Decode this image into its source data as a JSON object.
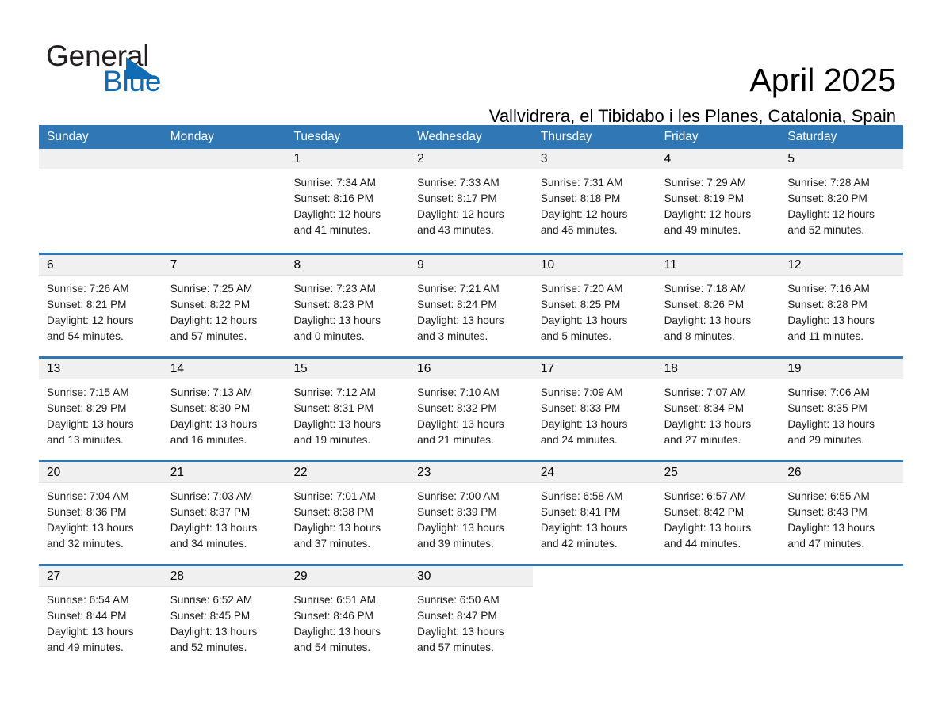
{
  "brand": {
    "word_one": "General",
    "word_two": "Blue",
    "accent_color": "#0f6cb5"
  },
  "header": {
    "month_title": "April 2025",
    "location": "Vallvidrera, el Tibidabo i les Planes, Catalonia, Spain",
    "header_bg": "#2f78b5",
    "day_band_bg": "#f0f0f0"
  },
  "calendar": {
    "weekdays": [
      "Sunday",
      "Monday",
      "Tuesday",
      "Wednesday",
      "Thursday",
      "Friday",
      "Saturday"
    ],
    "weeks": [
      [
        {
          "day": "",
          "sunrise": "",
          "sunset": "",
          "daylight_1": "",
          "daylight_2": "",
          "empty": true
        },
        {
          "day": "",
          "sunrise": "",
          "sunset": "",
          "daylight_1": "",
          "daylight_2": "",
          "empty": true
        },
        {
          "day": "1",
          "sunrise": "Sunrise: 7:34 AM",
          "sunset": "Sunset: 8:16 PM",
          "daylight_1": "Daylight: 12 hours",
          "daylight_2": "and 41 minutes."
        },
        {
          "day": "2",
          "sunrise": "Sunrise: 7:33 AM",
          "sunset": "Sunset: 8:17 PM",
          "daylight_1": "Daylight: 12 hours",
          "daylight_2": "and 43 minutes."
        },
        {
          "day": "3",
          "sunrise": "Sunrise: 7:31 AM",
          "sunset": "Sunset: 8:18 PM",
          "daylight_1": "Daylight: 12 hours",
          "daylight_2": "and 46 minutes."
        },
        {
          "day": "4",
          "sunrise": "Sunrise: 7:29 AM",
          "sunset": "Sunset: 8:19 PM",
          "daylight_1": "Daylight: 12 hours",
          "daylight_2": "and 49 minutes."
        },
        {
          "day": "5",
          "sunrise": "Sunrise: 7:28 AM",
          "sunset": "Sunset: 8:20 PM",
          "daylight_1": "Daylight: 12 hours",
          "daylight_2": "and 52 minutes."
        }
      ],
      [
        {
          "day": "6",
          "sunrise": "Sunrise: 7:26 AM",
          "sunset": "Sunset: 8:21 PM",
          "daylight_1": "Daylight: 12 hours",
          "daylight_2": "and 54 minutes."
        },
        {
          "day": "7",
          "sunrise": "Sunrise: 7:25 AM",
          "sunset": "Sunset: 8:22 PM",
          "daylight_1": "Daylight: 12 hours",
          "daylight_2": "and 57 minutes."
        },
        {
          "day": "8",
          "sunrise": "Sunrise: 7:23 AM",
          "sunset": "Sunset: 8:23 PM",
          "daylight_1": "Daylight: 13 hours",
          "daylight_2": "and 0 minutes."
        },
        {
          "day": "9",
          "sunrise": "Sunrise: 7:21 AM",
          "sunset": "Sunset: 8:24 PM",
          "daylight_1": "Daylight: 13 hours",
          "daylight_2": "and 3 minutes."
        },
        {
          "day": "10",
          "sunrise": "Sunrise: 7:20 AM",
          "sunset": "Sunset: 8:25 PM",
          "daylight_1": "Daylight: 13 hours",
          "daylight_2": "and 5 minutes."
        },
        {
          "day": "11",
          "sunrise": "Sunrise: 7:18 AM",
          "sunset": "Sunset: 8:26 PM",
          "daylight_1": "Daylight: 13 hours",
          "daylight_2": "and 8 minutes."
        },
        {
          "day": "12",
          "sunrise": "Sunrise: 7:16 AM",
          "sunset": "Sunset: 8:28 PM",
          "daylight_1": "Daylight: 13 hours",
          "daylight_2": "and 11 minutes."
        }
      ],
      [
        {
          "day": "13",
          "sunrise": "Sunrise: 7:15 AM",
          "sunset": "Sunset: 8:29 PM",
          "daylight_1": "Daylight: 13 hours",
          "daylight_2": "and 13 minutes."
        },
        {
          "day": "14",
          "sunrise": "Sunrise: 7:13 AM",
          "sunset": "Sunset: 8:30 PM",
          "daylight_1": "Daylight: 13 hours",
          "daylight_2": "and 16 minutes."
        },
        {
          "day": "15",
          "sunrise": "Sunrise: 7:12 AM",
          "sunset": "Sunset: 8:31 PM",
          "daylight_1": "Daylight: 13 hours",
          "daylight_2": "and 19 minutes."
        },
        {
          "day": "16",
          "sunrise": "Sunrise: 7:10 AM",
          "sunset": "Sunset: 8:32 PM",
          "daylight_1": "Daylight: 13 hours",
          "daylight_2": "and 21 minutes."
        },
        {
          "day": "17",
          "sunrise": "Sunrise: 7:09 AM",
          "sunset": "Sunset: 8:33 PM",
          "daylight_1": "Daylight: 13 hours",
          "daylight_2": "and 24 minutes."
        },
        {
          "day": "18",
          "sunrise": "Sunrise: 7:07 AM",
          "sunset": "Sunset: 8:34 PM",
          "daylight_1": "Daylight: 13 hours",
          "daylight_2": "and 27 minutes."
        },
        {
          "day": "19",
          "sunrise": "Sunrise: 7:06 AM",
          "sunset": "Sunset: 8:35 PM",
          "daylight_1": "Daylight: 13 hours",
          "daylight_2": "and 29 minutes."
        }
      ],
      [
        {
          "day": "20",
          "sunrise": "Sunrise: 7:04 AM",
          "sunset": "Sunset: 8:36 PM",
          "daylight_1": "Daylight: 13 hours",
          "daylight_2": "and 32 minutes."
        },
        {
          "day": "21",
          "sunrise": "Sunrise: 7:03 AM",
          "sunset": "Sunset: 8:37 PM",
          "daylight_1": "Daylight: 13 hours",
          "daylight_2": "and 34 minutes."
        },
        {
          "day": "22",
          "sunrise": "Sunrise: 7:01 AM",
          "sunset": "Sunset: 8:38 PM",
          "daylight_1": "Daylight: 13 hours",
          "daylight_2": "and 37 minutes."
        },
        {
          "day": "23",
          "sunrise": "Sunrise: 7:00 AM",
          "sunset": "Sunset: 8:39 PM",
          "daylight_1": "Daylight: 13 hours",
          "daylight_2": "and 39 minutes."
        },
        {
          "day": "24",
          "sunrise": "Sunrise: 6:58 AM",
          "sunset": "Sunset: 8:41 PM",
          "daylight_1": "Daylight: 13 hours",
          "daylight_2": "and 42 minutes."
        },
        {
          "day": "25",
          "sunrise": "Sunrise: 6:57 AM",
          "sunset": "Sunset: 8:42 PM",
          "daylight_1": "Daylight: 13 hours",
          "daylight_2": "and 44 minutes."
        },
        {
          "day": "26",
          "sunrise": "Sunrise: 6:55 AM",
          "sunset": "Sunset: 8:43 PM",
          "daylight_1": "Daylight: 13 hours",
          "daylight_2": "and 47 minutes."
        }
      ],
      [
        {
          "day": "27",
          "sunrise": "Sunrise: 6:54 AM",
          "sunset": "Sunset: 8:44 PM",
          "daylight_1": "Daylight: 13 hours",
          "daylight_2": "and 49 minutes."
        },
        {
          "day": "28",
          "sunrise": "Sunrise: 6:52 AM",
          "sunset": "Sunset: 8:45 PM",
          "daylight_1": "Daylight: 13 hours",
          "daylight_2": "and 52 minutes."
        },
        {
          "day": "29",
          "sunrise": "Sunrise: 6:51 AM",
          "sunset": "Sunset: 8:46 PM",
          "daylight_1": "Daylight: 13 hours",
          "daylight_2": "and 54 minutes."
        },
        {
          "day": "30",
          "sunrise": "Sunrise: 6:50 AM",
          "sunset": "Sunset: 8:47 PM",
          "daylight_1": "Daylight: 13 hours",
          "daylight_2": "and 57 minutes."
        },
        {
          "day": "",
          "sunrise": "",
          "sunset": "",
          "daylight_1": "",
          "daylight_2": "",
          "empty": true,
          "blank": true
        },
        {
          "day": "",
          "sunrise": "",
          "sunset": "",
          "daylight_1": "",
          "daylight_2": "",
          "empty": true,
          "blank": true
        },
        {
          "day": "",
          "sunrise": "",
          "sunset": "",
          "daylight_1": "",
          "daylight_2": "",
          "empty": true,
          "blank": true
        }
      ]
    ]
  }
}
